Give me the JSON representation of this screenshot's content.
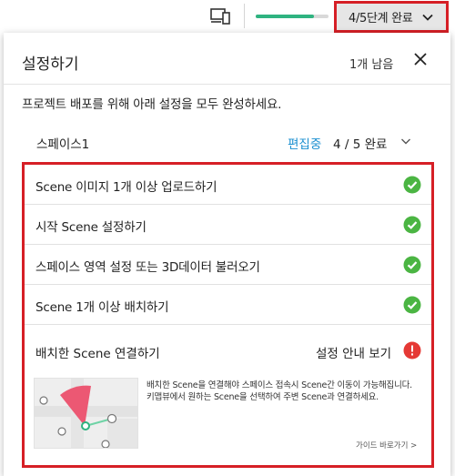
{
  "topbar": {
    "device_icon": "devices-icon",
    "progress_fraction": 0.8,
    "progress_button_label": "4/5단계 완료",
    "progress_button_icon": "chevron-down-icon",
    "accent_color": "#2fb380"
  },
  "panel": {
    "title": "설정하기",
    "remaining": "1개 남음",
    "close_icon": "close-icon",
    "description": "프로젝트 배포를 위해 아래 설정을 모두 완성하세요."
  },
  "space": {
    "name": "스페이스1",
    "status": "편집중",
    "progress": "4 / 5 완료"
  },
  "tasks": [
    {
      "label": "Scene 이미지 1개 이상 업로드하기",
      "done": true
    },
    {
      "label": "시작 Scene 설정하기",
      "done": true
    },
    {
      "label": "스페이스 영역 설정 또는 3D데이터 불러오기",
      "done": true
    },
    {
      "label": "Scene 1개 이상 배치하기",
      "done": true
    }
  ],
  "pending_task": {
    "label": "배치한 Scene 연결하기",
    "guide_label": "설정 안내 보기",
    "tip_line1": "배치한 Scene을 연결해야 스페이스 접속시 Scene간 이동이 가능해집니다.",
    "tip_line2": "키맵뷰에서 원하는 Scene을 선택하여 주변 Scene과 연결하세요.",
    "tip_link": "가이드 바로가기 >"
  },
  "colors": {
    "highlight": "#d61f26",
    "check": "#4bb543",
    "alert": "#e53935",
    "link": "#1a8fd0"
  }
}
